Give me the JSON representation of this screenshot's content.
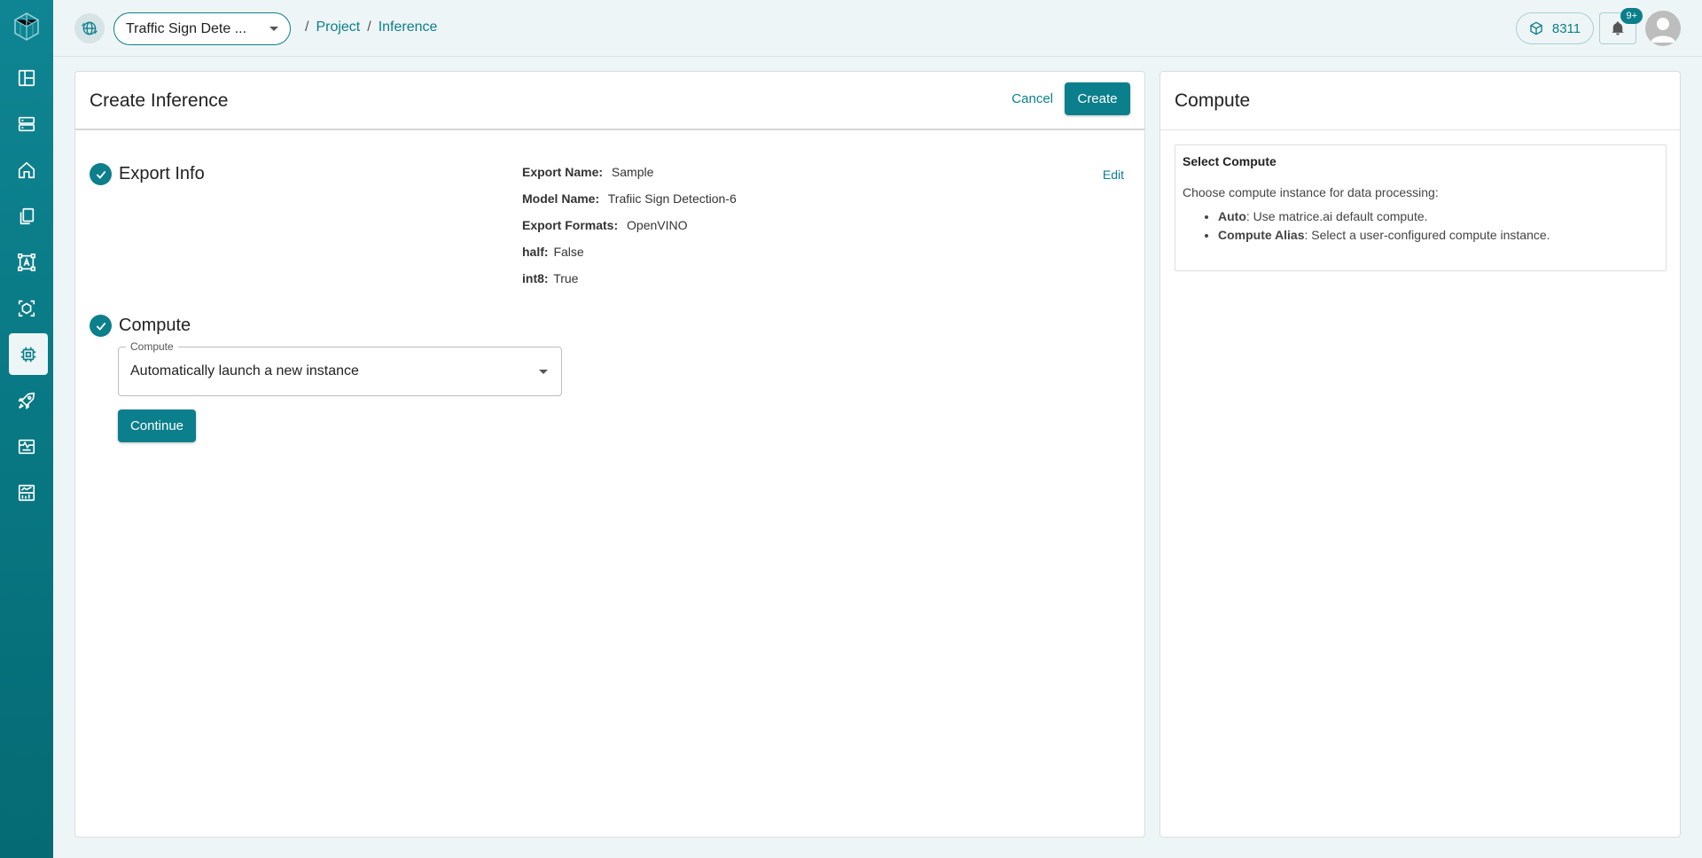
{
  "header": {
    "project_select": "Traffic Sign Dete ...",
    "breadcrumb": {
      "sep": "/",
      "project": "Project",
      "inference": "Inference"
    },
    "credits": "8311",
    "notifications_badge": "9+"
  },
  "sidebar": {
    "items": [
      {
        "name": "dashboard",
        "icon": "dashboard-icon"
      },
      {
        "name": "storage",
        "icon": "storage-icon"
      },
      {
        "name": "home",
        "icon": "home-icon"
      },
      {
        "name": "files",
        "icon": "files-icon"
      },
      {
        "name": "annotation",
        "icon": "annotation-icon"
      },
      {
        "name": "models",
        "icon": "model-icon"
      },
      {
        "name": "inference",
        "icon": "chip-icon",
        "active": true
      },
      {
        "name": "deploy",
        "icon": "rocket-icon"
      },
      {
        "name": "monitoring",
        "icon": "monitor-icon"
      },
      {
        "name": "analytics",
        "icon": "analytics-icon"
      }
    ]
  },
  "main": {
    "title": "Create Inference",
    "cancel_label": "Cancel",
    "create_label": "Create",
    "export_step_title": "Export Info",
    "edit_label": "Edit",
    "export_info": {
      "export_name_label": "Export Name:",
      "export_name": "Sample",
      "model_name_label": "Model Name:",
      "model_name": "Trafiic Sign Detection-6",
      "export_formats_label": "Export Formats:",
      "export_formats": "OpenVINO",
      "half_label": "half:",
      "half": "False",
      "int8_label": "int8:",
      "int8": "True"
    },
    "compute_step_title": "Compute",
    "compute_field_label": "Compute",
    "compute_field_value": "Automatically launch a new instance",
    "continue_label": "Continue"
  },
  "side": {
    "title": "Compute",
    "help_title": "Select Compute",
    "help_desc": "Choose compute instance for data processing:",
    "items": [
      {
        "term": "Auto",
        "text": ": Use matrice.ai default compute."
      },
      {
        "term": "Compute Alias",
        "text": ": Select a user-configured compute instance."
      }
    ]
  },
  "colors": {
    "accent": "#0b7f8b",
    "sidebar": "#087883",
    "background": "#eef5f6"
  }
}
